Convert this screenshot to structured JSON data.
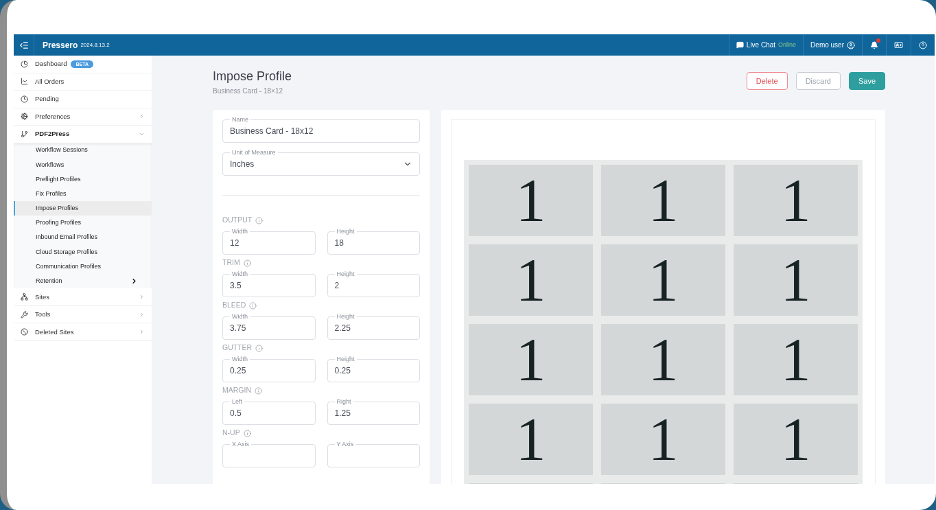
{
  "header": {
    "app_name": "Pressero",
    "version": "2024.8.13.2",
    "live_chat": "Live Chat",
    "chat_status": "Online",
    "user": "Demo user",
    "notifications_unread": true
  },
  "sidebar": {
    "items": [
      {
        "label": "Dashboard",
        "badge": "BETA",
        "selected": false,
        "has_submenu": false
      },
      {
        "label": "All Orders",
        "selected": false,
        "has_submenu": false
      },
      {
        "label": "Pending",
        "selected": false,
        "has_submenu": false
      },
      {
        "label": "Preferences",
        "selected": false,
        "has_submenu": true,
        "expanded": false
      },
      {
        "label": "PDF2Press",
        "selected": false,
        "has_submenu": true,
        "expanded": true,
        "children": [
          {
            "label": "Workflow Sessions",
            "selected": false
          },
          {
            "label": "Workflows",
            "selected": false
          },
          {
            "label": "Preflight Profiles",
            "selected": false
          },
          {
            "label": "Fix Profiles",
            "selected": false
          },
          {
            "label": "Impose Profiles",
            "selected": true
          },
          {
            "label": "Proofing Profiles",
            "selected": false
          },
          {
            "label": "Inbound Email Profiles",
            "selected": false
          },
          {
            "label": "Cloud Storage Profiles",
            "selected": false
          },
          {
            "label": "Communication Profiles",
            "selected": false
          },
          {
            "label": "Retention",
            "selected": false,
            "has_submenu": true
          }
        ]
      },
      {
        "label": "Sites",
        "selected": false,
        "has_submenu": true,
        "expanded": false
      },
      {
        "label": "Tools",
        "selected": false,
        "has_submenu": true,
        "expanded": false
      },
      {
        "label": "Deleted Sites",
        "selected": false,
        "has_submenu": true,
        "expanded": false
      }
    ]
  },
  "page": {
    "title": "Impose Profile",
    "subtitle": "Business Card - 18×12",
    "buttons": [
      {
        "label": "Delete",
        "kind": "danger"
      },
      {
        "label": "Discard",
        "kind": "neutral"
      },
      {
        "label": "Save",
        "kind": "primary"
      }
    ]
  },
  "form": {
    "name": {
      "label": "Name",
      "value": "Business Card - 18x12"
    },
    "unit": {
      "label": "Unit of Measure",
      "value": "Inches"
    },
    "sections": [
      {
        "title": "OUTPUT",
        "fields": [
          {
            "label": "Width",
            "value": "12"
          },
          {
            "label": "Height",
            "value": "18"
          }
        ]
      },
      {
        "title": "TRIM",
        "fields": [
          {
            "label": "Width",
            "value": "3.5"
          },
          {
            "label": "Height",
            "value": "2"
          }
        ]
      },
      {
        "title": "BLEED",
        "fields": [
          {
            "label": "Width",
            "value": "3.75"
          },
          {
            "label": "Height",
            "value": "2.25"
          }
        ]
      },
      {
        "title": "GUTTER",
        "fields": [
          {
            "label": "Width",
            "value": "0.25"
          },
          {
            "label": "Height",
            "value": "0.25"
          }
        ]
      },
      {
        "title": "MARGIN",
        "fields": [
          {
            "label": "Left",
            "value": "0.5"
          },
          {
            "label": "Right",
            "value": "1.25"
          }
        ]
      },
      {
        "title": "N-UP",
        "fields": [
          {
            "label": "X Axis"
          },
          {
            "label": "Y Axis"
          }
        ]
      }
    ]
  },
  "preview": {
    "rows": [
      [
        "1",
        "1",
        "1"
      ],
      [
        "1",
        "1",
        "1"
      ],
      [
        "1",
        "1",
        "1"
      ],
      [
        "1",
        "1",
        "1"
      ]
    ]
  }
}
